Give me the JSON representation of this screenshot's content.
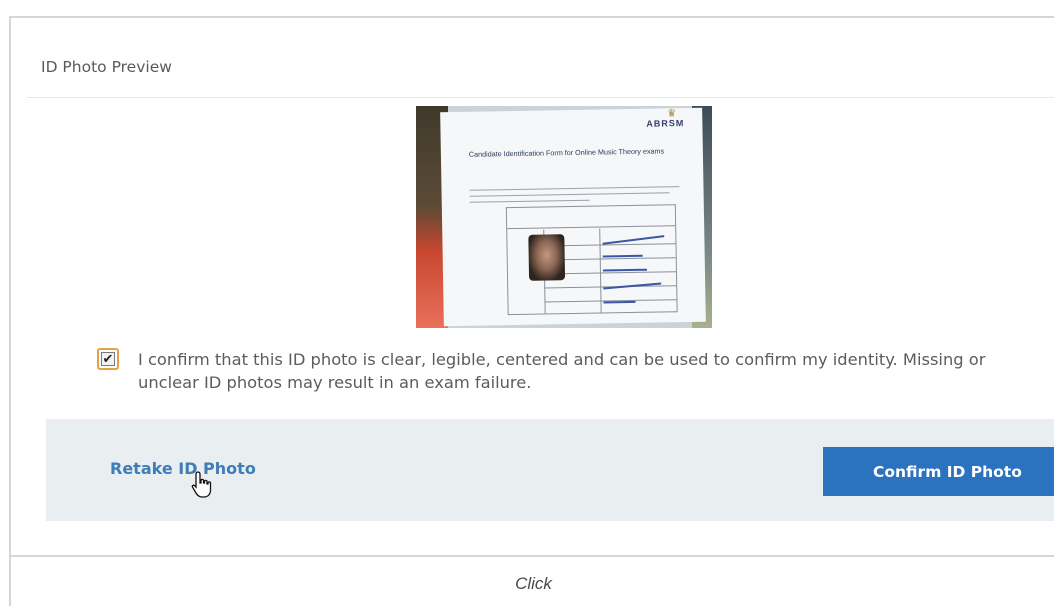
{
  "panel": {
    "title": "ID Photo Preview"
  },
  "photo": {
    "alt": "ID photo of candidate holding identification form",
    "logo_text": "ABRSM",
    "form_heading": "Candidate Identification Form for Online Music Theory exams"
  },
  "confirmation": {
    "checked": true,
    "text": "I confirm that this ID photo is clear, legible, centered and can be used to confirm my identity. Missing or unclear ID photos may result in an exam failure."
  },
  "actions": {
    "retake_label": "Retake ID Photo",
    "confirm_label": "Confirm ID Photo"
  },
  "caption": "Click",
  "colors": {
    "accent": "#2b72bf",
    "link": "#3f7cb8",
    "checkbox_border": "#e2a24a",
    "action_bar_bg": "#e9eef1"
  }
}
